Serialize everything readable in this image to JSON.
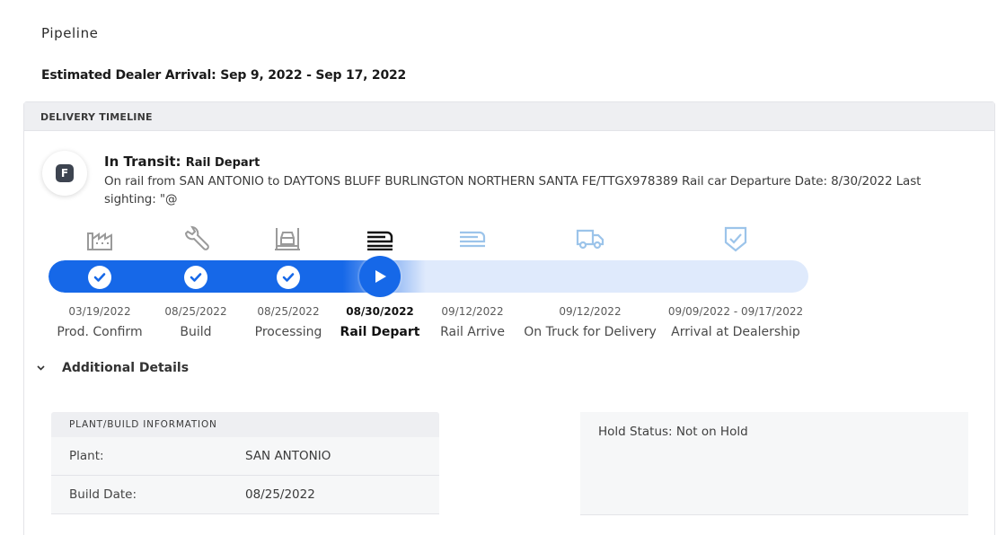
{
  "page": {
    "title": "Pipeline",
    "eta": "Estimated Dealer Arrival: Sep 9, 2022 - Sep 17, 2022"
  },
  "timeline": {
    "header": "DELIVERY TIMELINE",
    "status_badge": "F",
    "status_label": "In Transit:",
    "status_sub": "Rail Depart",
    "status_desc": "On rail from SAN ANTONIO to DAYTONS BLUFF BURLINGTON NORTHERN SANTA FE/TTGX978389 Rail car Departure Date: 8/30/2022 Last sighting: \"@",
    "progress_percent": 44,
    "stages": [
      {
        "label": "Prod. Confirm",
        "date": "03/19/2022",
        "icon": "factory-icon",
        "state": "complete"
      },
      {
        "label": "Build",
        "date": "08/25/2022",
        "icon": "wrench-icon",
        "state": "complete"
      },
      {
        "label": "Processing",
        "date": "08/25/2022",
        "icon": "car-lift-icon",
        "state": "complete"
      },
      {
        "label": "Rail Depart",
        "date": "08/30/2022",
        "icon": "train-icon",
        "state": "current"
      },
      {
        "label": "Rail Arrive",
        "date": "09/12/2022",
        "icon": "train-icon",
        "state": "pending"
      },
      {
        "label": "On Truck for Delivery",
        "date": "09/12/2022",
        "icon": "truck-icon",
        "state": "pending"
      },
      {
        "label": "Arrival at Dealership",
        "date": "09/09/2022 - 09/17/2022",
        "icon": "shield-check-icon",
        "state": "pending"
      }
    ]
  },
  "details": {
    "toggle_label": "Additional Details",
    "plant_header": "PLANT/BUILD INFORMATION",
    "plant_rows": [
      {
        "key": "Plant:",
        "value": "SAN ANTONIO"
      },
      {
        "key": "Build Date:",
        "value": "08/25/2022"
      }
    ],
    "hold_status": "Hold Status: Not on Hold"
  },
  "colors": {
    "accent": "#1668e8",
    "track": "#dfeafc",
    "done_icon": "#9a9a9a",
    "pending_icon": "#9cc4ea"
  }
}
